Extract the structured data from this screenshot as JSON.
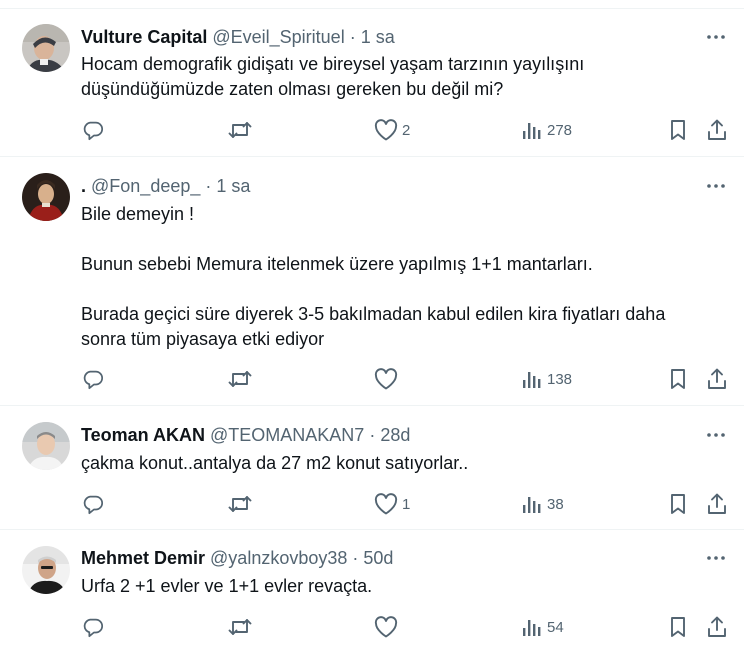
{
  "tweets": [
    {
      "name": "Vulture Capital",
      "handle": "@Eveil_Spirituel",
      "separator": "·",
      "time": "1 sa",
      "lines": [
        "Hocam demografik gidişatı ve bireysel yaşam tarzının yayılışını",
        "düşündüğümüzde zaten olması gereken bu değil mi?"
      ],
      "likes": "2",
      "views": "278",
      "avatar_colors": [
        "#c9c6c2",
        "#3a3d44"
      ]
    },
    {
      "name": ".",
      "handle": "@Fon_deep_",
      "separator": "·",
      "time": "1 sa",
      "paragraphs": [
        "Bile demeyin !",
        "Bunun sebebi Memura itelenmek üzere yapılmış 1+1 mantarları.",
        "Burada geçici süre diyerek 3-5 bakılmadan kabul edilen kira fiyatları daha",
        "sonra tüm piyasaya etki ediyor"
      ],
      "likes": "",
      "views": "138",
      "avatar_colors": [
        "#2a1f1a",
        "#9a1f1a"
      ]
    },
    {
      "name": "Teoman AKAN",
      "handle": "@TEOMANAKAN7",
      "separator": "·",
      "time": "28d",
      "lines": [
        "çakma konut..antalya da 27 m2 konut satıyorlar.."
      ],
      "likes": "1",
      "views": "38",
      "avatar_colors": [
        "#d8d8d8",
        "#e9c9b0"
      ]
    },
    {
      "name": "Mehmet Demir",
      "handle": "@yalnzkovboy38",
      "separator": "·",
      "time": "50d",
      "lines": [
        "Urfa 2 +1 evler ve 1+1 evler revaçta."
      ],
      "likes": "",
      "views": "54",
      "avatar_colors": [
        "#f2f2f2",
        "#1c1c1c"
      ]
    }
  ],
  "icons": {
    "reply": "reply-icon",
    "retweet": "retweet-icon",
    "like": "like-icon",
    "views": "views-icon",
    "bookmark": "bookmark-icon",
    "share": "share-icon",
    "more": "more-icon"
  },
  "colors": {
    "text_primary": "#0f1419",
    "text_secondary": "#536471",
    "divider": "#eff3f4"
  }
}
